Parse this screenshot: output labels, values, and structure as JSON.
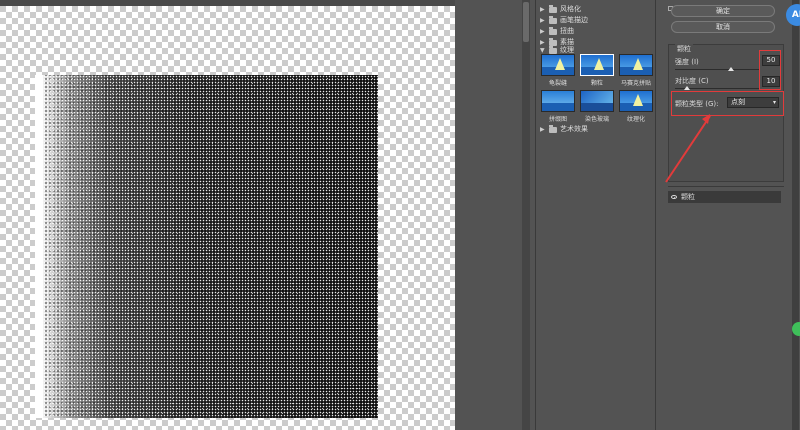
{
  "filter_gallery": {
    "categories": [
      {
        "label": "风格化",
        "expanded": false
      },
      {
        "label": "画笔描边",
        "expanded": false
      },
      {
        "label": "扭曲",
        "expanded": false
      },
      {
        "label": "素描",
        "expanded": false
      },
      {
        "label": "纹理",
        "expanded": true
      },
      {
        "label": "艺术效果",
        "expanded": false
      }
    ],
    "texture_filters": [
      {
        "label": "龟裂缝",
        "selected": false
      },
      {
        "label": "颗粒",
        "selected": true
      },
      {
        "label": "马赛克拼贴",
        "selected": false
      },
      {
        "label": "拼缀图",
        "selected": false
      },
      {
        "label": "染色玻璃",
        "selected": false
      },
      {
        "label": "纹理化",
        "selected": false
      }
    ]
  },
  "dialog": {
    "ok_label": "确定",
    "cancel_label": "取消",
    "badge_text": "AI"
  },
  "settings": {
    "section_title": "颗粒",
    "intensity_label": "强度 (I)",
    "intensity_value": "50",
    "contrast_label": "对比度 (C)",
    "contrast_value": "10",
    "grain_type_label": "颗粒类型 (G):",
    "grain_type_value": "点刻"
  },
  "effect_layers": [
    {
      "label": "颗粒"
    }
  ],
  "colors": {
    "highlight": "#e23b3b",
    "panel_bg": "#535353"
  }
}
